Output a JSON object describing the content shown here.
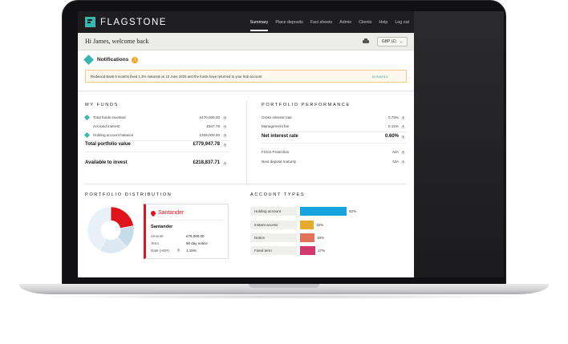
{
  "nav": {
    "brand": "FLAGSTONE",
    "items": [
      "Summary",
      "Place deposits",
      "Fact sheets",
      "Admin",
      "Clients",
      "Help",
      "Log out"
    ],
    "active": "Summary"
  },
  "welcome": {
    "text": "Hi James, welcome back",
    "currency": "GBP (£)"
  },
  "notifications": {
    "title": "Notifications",
    "count": "1",
    "message": "Redwood Bank 6 months fixed 1.3% matured on 10 June 2020 and the funds have returned to your hub account",
    "dismiss": "DISMISS"
  },
  "my_funds": {
    "title": "MY FUNDS",
    "total_funds_label": "Total funds invested",
    "total_funds_value": "£470,000.00",
    "accrued_label": "Accrued interest",
    "accrued_value": "£947.78",
    "holding_label": "Holding account balance",
    "holding_value": "£309,000.00",
    "portfolio_label": "Total portfolio value",
    "portfolio_value": "£779,947.78",
    "available_label": "Available to invest",
    "available_value": "£218,837.71",
    "help": "?"
  },
  "performance": {
    "title": "PORTFOLIO PERFORMANCE",
    "gross_label": "Gross interest rate",
    "gross_value": "0.75%",
    "fee_label": "Management fee",
    "fee_value": "0.15%",
    "net_label": "Net interest rate",
    "net_value": "0.60%",
    "fscs_label": "FSCS Protection",
    "fscs_value": "N/A",
    "next_label": "Next deposit maturity",
    "next_value": "N/A"
  },
  "distribution": {
    "title": "PORTFOLIO DISTRIBUTION",
    "segments": [
      {
        "share": 0.22,
        "color": "#e0131a"
      },
      {
        "share": 0.16,
        "color": "#c7dbe8"
      },
      {
        "share": 0.2,
        "color": "#dce8f2"
      },
      {
        "share": 0.42,
        "color": "#e8f1f8"
      }
    ],
    "bank": {
      "logo": "Santander",
      "name": "Santander",
      "amount_label": "Amount",
      "amount_value": "£75,000.00",
      "term_label": "Term",
      "term_value": "90 day notice",
      "rate_label": "Rate (AER)",
      "rate_value": "1.15%"
    }
  },
  "account_types": {
    "title": "ACCOUNT TYPES",
    "items": [
      {
        "label": "Holding account",
        "pct": "52%",
        "share": 0.52,
        "color": "#17a2e0"
      },
      {
        "label": "Instant access",
        "pct": "15%",
        "share": 0.15,
        "color": "#e6ab2e"
      },
      {
        "label": "Notice",
        "pct": "16%",
        "share": 0.16,
        "color": "#e2715a"
      },
      {
        "label": "Fixed term",
        "pct": "17%",
        "share": 0.17,
        "color": "#d13a6a"
      }
    ]
  }
}
